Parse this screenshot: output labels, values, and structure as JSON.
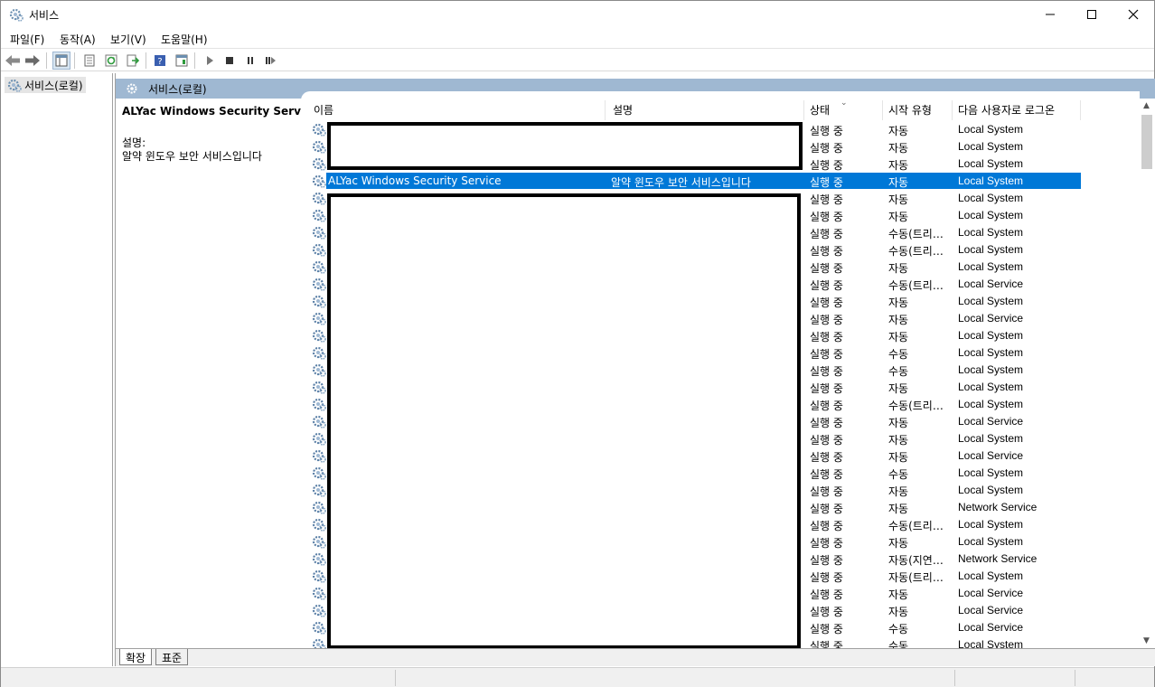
{
  "window": {
    "title": "서비스"
  },
  "menu": [
    {
      "label": "파일(F)"
    },
    {
      "label": "동작(A)"
    },
    {
      "label": "보기(V)"
    },
    {
      "label": "도움말(H)"
    }
  ],
  "tree": {
    "root_label": "서비스(로컬)"
  },
  "panel": {
    "header_title": "서비스(로컬)"
  },
  "detail": {
    "service_name": "ALYac Windows Security Service",
    "desc_label": "설명:",
    "desc_text": "알약 윈도우 보안 서비스입니다"
  },
  "columns": {
    "name": "이름",
    "desc": "설명",
    "status": "상태",
    "start": "시작 유형",
    "logon": "다음 사용자로 로그온"
  },
  "rows": [
    {
      "name": "",
      "desc": "",
      "status": "실행 중",
      "start": "자동",
      "logon": "Local System"
    },
    {
      "name": "",
      "desc": "",
      "status": "실행 중",
      "start": "자동",
      "logon": "Local System"
    },
    {
      "name": "",
      "desc": "",
      "status": "실행 중",
      "start": "자동",
      "logon": "Local System"
    },
    {
      "name": "ALYac Windows Security Service",
      "desc": "알약 윈도우 보안 서비스입니다",
      "status": "실행 중",
      "start": "자동",
      "logon": "Local System",
      "selected": true
    },
    {
      "name": "",
      "desc": "",
      "status": "실행 중",
      "start": "자동",
      "logon": "Local System"
    },
    {
      "name": "",
      "desc": "",
      "status": "실행 중",
      "start": "자동",
      "logon": "Local System"
    },
    {
      "name": "",
      "desc": "",
      "status": "실행 중",
      "start": "수동(트리…",
      "logon": "Local System"
    },
    {
      "name": "",
      "desc": "",
      "status": "실행 중",
      "start": "수동(트리…",
      "logon": "Local System"
    },
    {
      "name": "",
      "desc": "",
      "status": "실행 중",
      "start": "자동",
      "logon": "Local System"
    },
    {
      "name": "",
      "desc": "",
      "status": "실행 중",
      "start": "수동(트리…",
      "logon": "Local Service"
    },
    {
      "name": "",
      "desc": "",
      "status": "실행 중",
      "start": "자동",
      "logon": "Local System"
    },
    {
      "name": "",
      "desc": "",
      "status": "실행 중",
      "start": "자동",
      "logon": "Local Service"
    },
    {
      "name": "",
      "desc": "",
      "status": "실행 중",
      "start": "자동",
      "logon": "Local System"
    },
    {
      "name": "",
      "desc": "",
      "status": "실행 중",
      "start": "수동",
      "logon": "Local System"
    },
    {
      "name": "",
      "desc": "",
      "status": "실행 중",
      "start": "수동",
      "logon": "Local System"
    },
    {
      "name": "",
      "desc": "",
      "status": "실행 중",
      "start": "자동",
      "logon": "Local System"
    },
    {
      "name": "",
      "desc": "",
      "status": "실행 중",
      "start": "수동(트리…",
      "logon": "Local System"
    },
    {
      "name": "",
      "desc": "",
      "status": "실행 중",
      "start": "자동",
      "logon": "Local Service"
    },
    {
      "name": "",
      "desc": "",
      "status": "실행 중",
      "start": "자동",
      "logon": "Local System"
    },
    {
      "name": "",
      "desc": "",
      "status": "실행 중",
      "start": "자동",
      "logon": "Local Service"
    },
    {
      "name": "",
      "desc": "",
      "status": "실행 중",
      "start": "수동",
      "logon": "Local System"
    },
    {
      "name": "",
      "desc": "",
      "status": "실행 중",
      "start": "자동",
      "logon": "Local System"
    },
    {
      "name": "",
      "desc": "",
      "status": "실행 중",
      "start": "자동",
      "logon": "Network Service"
    },
    {
      "name": "",
      "desc": "",
      "status": "실행 중",
      "start": "수동(트리…",
      "logon": "Local System"
    },
    {
      "name": "",
      "desc": "",
      "status": "실행 중",
      "start": "자동",
      "logon": "Local System"
    },
    {
      "name": "",
      "desc": "",
      "status": "실행 중",
      "start": "자동(지연…",
      "logon": "Network Service"
    },
    {
      "name": "",
      "desc": "",
      "status": "실행 중",
      "start": "자동(트리…",
      "logon": "Local System"
    },
    {
      "name": "",
      "desc": "",
      "status": "실행 중",
      "start": "자동",
      "logon": "Local Service"
    },
    {
      "name": "",
      "desc": "",
      "status": "실행 중",
      "start": "자동",
      "logon": "Local Service"
    },
    {
      "name": "",
      "desc": "",
      "status": "실행 중",
      "start": "수동",
      "logon": "Local Service"
    },
    {
      "name": "",
      "desc": "",
      "status": "실행 중",
      "start": "수동",
      "logon": "Local System"
    }
  ],
  "tabs": [
    {
      "label": "확장"
    },
    {
      "label": "표준"
    }
  ],
  "colors": {
    "selection": "#0078d7",
    "header_band": "#9fb8d2"
  }
}
